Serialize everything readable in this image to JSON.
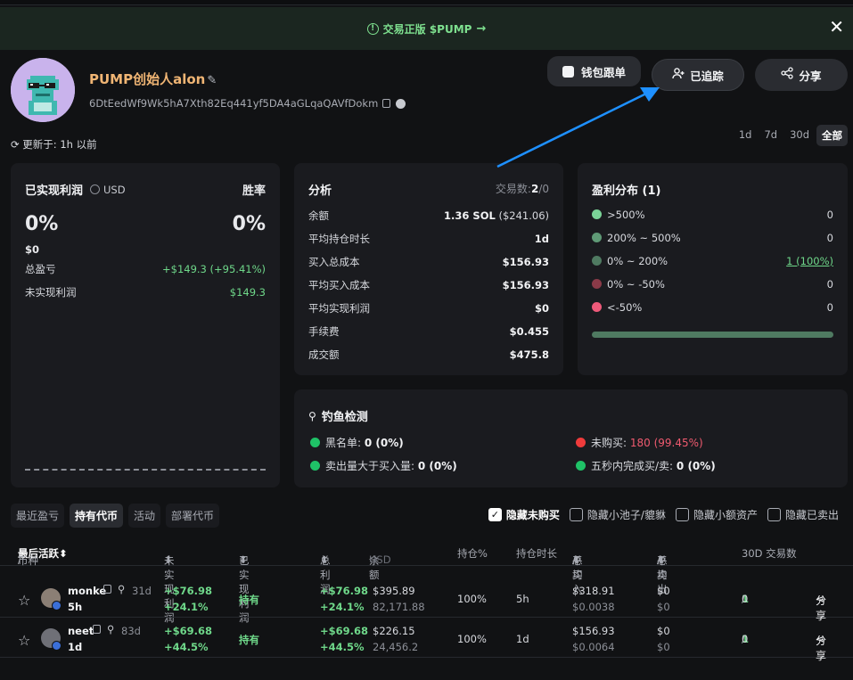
{
  "banner": {
    "text": "交易正版 $PUMP",
    "info_icon": "info-icon",
    "arrow_icon": "arrow-right-icon",
    "close_icon": "close-icon"
  },
  "profile": {
    "name": "PUMP创始人alon",
    "edit_icon": "pencil-icon",
    "address": "6DtEedWf9Wk5hA7Xth82Eq441yf5DA4aGLqaQAVfDokm",
    "updated": "更新于: 1h 以前"
  },
  "actions": {
    "wallet_follow": "钱包跟单",
    "followed": "已追踪",
    "share": "分享"
  },
  "periods": [
    "1d",
    "7d",
    "30d",
    "全部"
  ],
  "active_period": "全部",
  "pnl": {
    "title": "已实现利润",
    "currency": "USD",
    "winrate_label": "胜率",
    "realized_pct": "0%",
    "realized_usd": "$0",
    "winrate": "0%",
    "total_pnl_label": "总盈亏",
    "total_pnl": "+$149.3 (+95.41%)",
    "unrealized_label": "未实现利润",
    "unrealized": "$149.3"
  },
  "analysis": {
    "title": "分析",
    "trades_label": "交易数:",
    "trades_buy": "2",
    "trades_sep": "/",
    "trades_sell": "0",
    "rows": [
      {
        "label": "余额",
        "value": "1.36 SOL",
        "extra": "($241.06)"
      },
      {
        "label": "平均持仓时长",
        "value": "1d"
      },
      {
        "label": "买入总成本",
        "value": "$156.93"
      },
      {
        "label": "平均买入成本",
        "value": "$156.93"
      },
      {
        "label": "平均实现利润",
        "value": "$0"
      },
      {
        "label": "手续费",
        "value": "$0.455"
      },
      {
        "label": "成交额",
        "value": "$475.8"
      }
    ]
  },
  "distribution": {
    "title": "盈利分布 (1)",
    "rows": [
      {
        "label": ">500%",
        "value": "0",
        "color": "#7ad397"
      },
      {
        "label": "200% ~ 500%",
        "value": "0",
        "color": "#5f9a76"
      },
      {
        "label": "0% ~ 200%",
        "value": "1 (100%)",
        "color": "#4f7a61"
      },
      {
        "label": "0% ~ -50%",
        "value": "0",
        "color": "#8a3a48"
      },
      {
        "label": "<-50%",
        "value": "0",
        "color": "#ef5a7a"
      }
    ]
  },
  "phishing": {
    "title": "钓鱼检测",
    "items": [
      {
        "label": "黑名单:",
        "value": "0 (0%)",
        "color": "#1fc267"
      },
      {
        "label": "未购买:",
        "value": "180 (99.45%)",
        "color": "#ef3b3b",
        "value_color": "#ef5a6f"
      },
      {
        "label": "卖出量大于买入量:",
        "value": "0 (0%)",
        "color": "#1fc267"
      },
      {
        "label": "五秒内完成买/卖:",
        "value": "0 (0%)",
        "color": "#1fc267"
      }
    ]
  },
  "tabs": [
    "最近盈亏",
    "持有代币",
    "活动",
    "部署代币"
  ],
  "active_tab": "持有代币",
  "filters": [
    {
      "label": "隐藏未购买",
      "checked": true
    },
    {
      "label": "隐藏小池子/貔貅",
      "checked": false
    },
    {
      "label": "隐藏小额资产",
      "checked": false
    },
    {
      "label": "隐藏已卖出",
      "checked": false
    }
  ],
  "table": {
    "headers": {
      "token": "币种",
      "token_sep": "/",
      "last_active": "最后活跃",
      "unrealized": "未实现利润",
      "realized": "已实现利润",
      "total": "总利润",
      "balance": "余额",
      "balance_unit": "USD",
      "holding_pct": "持仓%",
      "hold_time": "持仓时长",
      "total_buy": "总买入",
      "buy_sep": "/",
      "avg": "平均",
      "total_sell": "总卖出",
      "sell_sep": "/",
      "avg2": "平均",
      "tx30d": "30D 交易数"
    },
    "rows": [
      {
        "name": "monke",
        "age": "31d",
        "last": "5h",
        "unrealized": "+$76.98",
        "unrealized_pct": "+24.1%",
        "realized": "持有",
        "total": "+$76.98",
        "total_pct": "+24.1%",
        "balance_usd": "$395.89",
        "balance_amt": "82,171.88",
        "holding_pct": "100%",
        "hold_time": "5h",
        "buy_total": "$318.91",
        "buy_avg": "$0.0038",
        "sell_total": "$0",
        "sell_avg": "$0",
        "tx_buy": "1",
        "tx_sep": "/",
        "tx_sell": "0",
        "share": "分享"
      },
      {
        "name": "neet",
        "age": "83d",
        "last": "1d",
        "unrealized": "+$69.68",
        "unrealized_pct": "+44.5%",
        "realized": "持有",
        "total": "+$69.68",
        "total_pct": "+44.5%",
        "balance_usd": "$226.15",
        "balance_amt": "24,456.2",
        "holding_pct": "100%",
        "hold_time": "1d",
        "buy_total": "$156.93",
        "buy_avg": "$0.0064",
        "sell_total": "$0",
        "sell_avg": "$0",
        "tx_buy": "1",
        "tx_sep": "/",
        "tx_sell": "0",
        "share": "分享"
      }
    ]
  },
  "colors": {
    "accent_green": "#6fd88a",
    "accent_red": "#ef5a6f",
    "bg": "#111214",
    "card": "#1a1b1f",
    "annotation_arrow": "#1e90ff"
  }
}
